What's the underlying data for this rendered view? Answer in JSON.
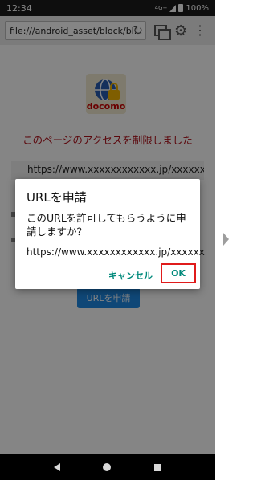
{
  "status_bar": {
    "time": "12:34",
    "network": "4G+",
    "battery": "100%"
  },
  "browser": {
    "url": "file:///android_asset/block/bl..."
  },
  "page": {
    "logo_text": "docomo",
    "blocked_title": "このページのアクセスを制限しました",
    "url_line": "https://www.xxxxxxxxxxxx.jp/xxxxxx",
    "apply_button": "URLを申請"
  },
  "dialog": {
    "title": "URLを申請",
    "message": "このURLを許可してもらうように申請しますか？",
    "url": "https://www.xxxxxxxxxxxx.jp/xxxxxx",
    "cancel_label": "キャンセル",
    "ok_label": "OK"
  },
  "colors": {
    "accent_teal": "#00897b",
    "highlight_red": "#e01b1b",
    "blocked_title": "#b0101a"
  }
}
